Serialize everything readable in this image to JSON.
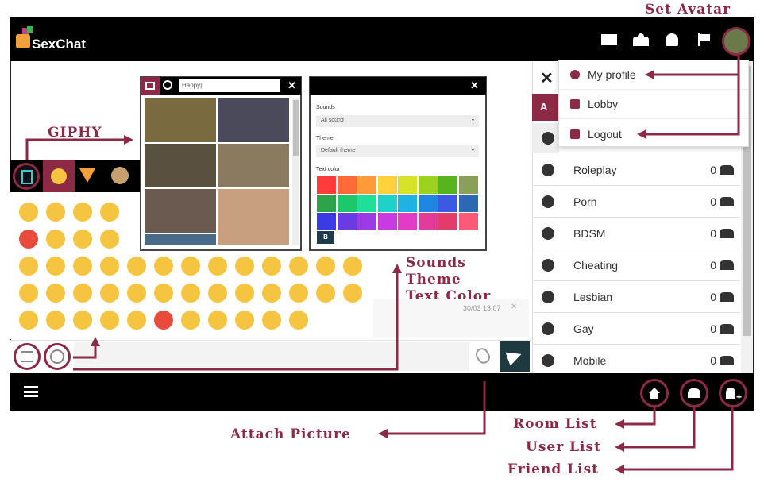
{
  "brand": {
    "logo_text": "SexChat"
  },
  "annotations": {
    "set_avatar": "Set Avatar",
    "giphy": "GIPHY",
    "sounds": "Sounds",
    "theme": "Theme",
    "text_color": "Text Color",
    "attach_picture": "Attach Picture",
    "room_list": "Room List",
    "user_list": "User List",
    "friend_list": "Friend List"
  },
  "user_menu": {
    "items": [
      "My profile",
      "Lobby",
      "Logout"
    ]
  },
  "gif_panel": {
    "search_value": "Happy|"
  },
  "settings_panel": {
    "sounds_label": "Sounds",
    "sounds_value": "All sound",
    "theme_label": "Theme",
    "theme_value": "Default theme",
    "text_color_label": "Text color",
    "bold_label": "B",
    "colors": [
      "#ff3b3b",
      "#ff6a3b",
      "#ff9a3b",
      "#ffd23b",
      "#d7e32b",
      "#9ad21e",
      "#57b31e",
      "#8aa05a",
      "#2fa34a",
      "#1ec86a",
      "#1ee09a",
      "#1ed2c8",
      "#1eb3e3",
      "#1e86e3",
      "#3b5ae3",
      "#2a6ab3",
      "#3b3be3",
      "#6a3be3",
      "#9a3be3",
      "#c83be3",
      "#e33bc8",
      "#e33b9a",
      "#e33b6a",
      "#ff5a7a"
    ]
  },
  "chat": {
    "timestamp": "30/03 13:07"
  },
  "rooms": [
    {
      "name": "Roleplay",
      "count": "0"
    },
    {
      "name": "Porn",
      "count": "0"
    },
    {
      "name": "BDSM",
      "count": "0"
    },
    {
      "name": "Cheating",
      "count": "0"
    },
    {
      "name": "Lesbian",
      "count": "0"
    },
    {
      "name": "Gay",
      "count": "0"
    },
    {
      "name": "Mobile",
      "count": "0"
    }
  ],
  "room_panel": {
    "add_label": "A"
  }
}
